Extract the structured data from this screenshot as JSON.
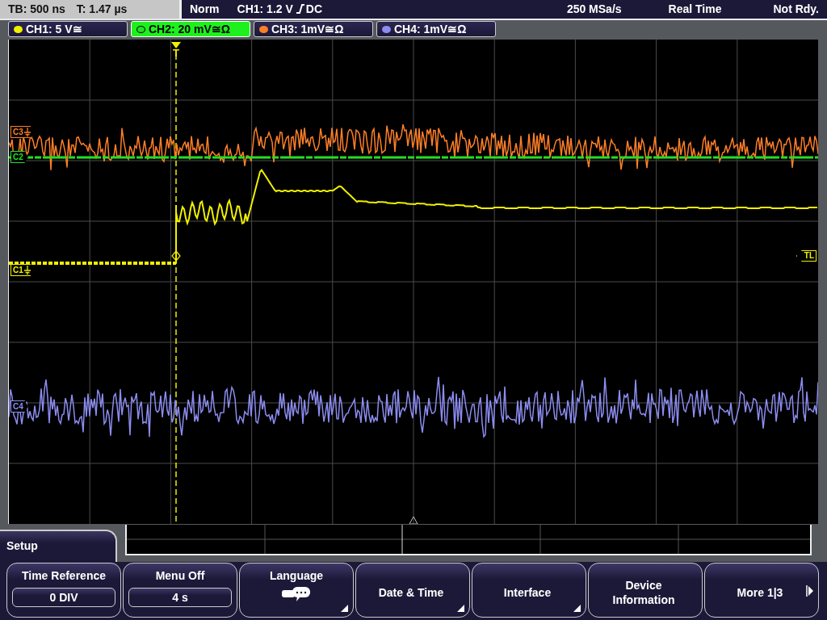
{
  "top_bar": {
    "timebase": "TB: 500 ns",
    "trigger_time": "T: 1.47 µs",
    "trigger_mode": "Norm",
    "trigger_source": "CH1: 1.2 V",
    "trigger_coupling": "DC",
    "sample_rate": "250 MSa/s",
    "acquisition": "Real Time",
    "status": "Not Rdy."
  },
  "channels": [
    {
      "label": "CH1: 5 V≅",
      "color": "#f0f000",
      "selected": false
    },
    {
      "label": "CH2: 20 mV≅Ω",
      "color": "#22e022",
      "selected": true
    },
    {
      "label": "CH3: 1mV≅Ω",
      "color": "#ff7f27",
      "selected": false
    },
    {
      "label": "CH4: 1mV≅Ω",
      "color": "#8c8cf0",
      "selected": false
    }
  ],
  "screen": {
    "trigger_marker": "T",
    "trigger_level_marker": "TL",
    "trace_markers": [
      {
        "label": "C3",
        "color": "#ff7f27",
        "ground": true
      },
      {
        "label": "C2",
        "color": "#22e022",
        "ground": false
      },
      {
        "label": "C1",
        "color": "#f0f000",
        "ground": true
      },
      {
        "label": "C4",
        "color": "#8c8cf0",
        "ground": false
      }
    ]
  },
  "menu": {
    "title": "Setup",
    "softkeys": [
      {
        "kind": "value",
        "label": "Time Reference",
        "value": "0 DIV"
      },
      {
        "kind": "value",
        "label": "Menu Off",
        "value": "4 s"
      },
      {
        "kind": "icon",
        "label": "Language",
        "submenu": true
      },
      {
        "kind": "plain",
        "label": "Date & Time",
        "submenu": true
      },
      {
        "kind": "plain",
        "label": "Interface",
        "submenu": true
      },
      {
        "kind": "plain",
        "label": "Device Information",
        "submenu": false
      },
      {
        "kind": "next",
        "label": "More 1|3",
        "submenu": false
      }
    ]
  }
}
